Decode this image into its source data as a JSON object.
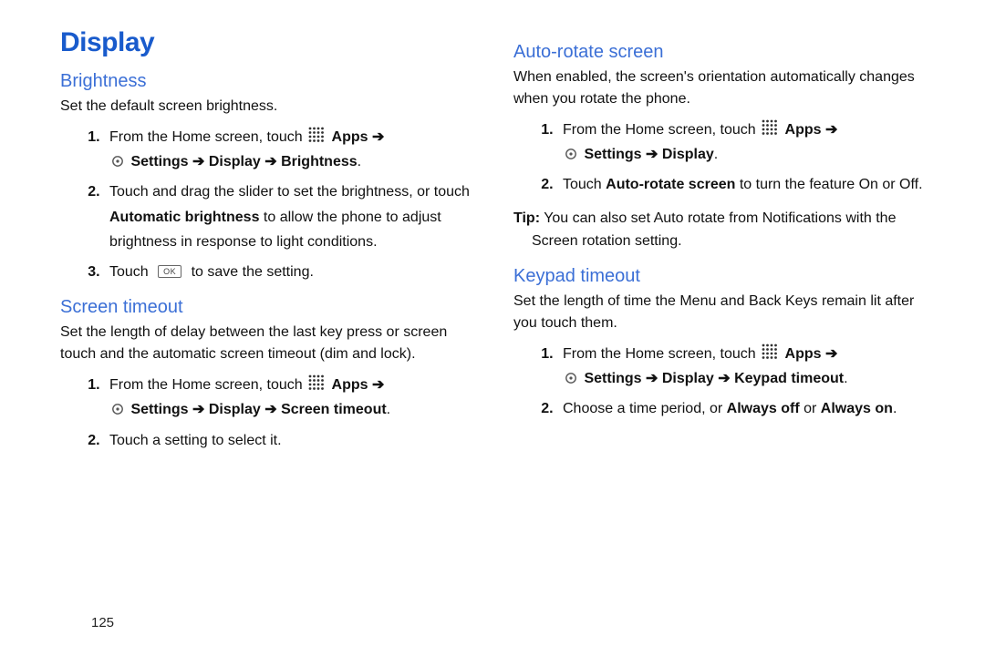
{
  "title": "Display",
  "pageNumber": "125",
  "left": {
    "brightness": {
      "heading": "Brightness",
      "intro": "Set the default screen brightness.",
      "steps": {
        "s1_a": "From the Home screen, touch ",
        "s1_apps": "Apps",
        "s1_arrow": " ➔ ",
        "s1_path": "Settings ➔ Display ➔ Brightness",
        "s1_period": ".",
        "s2_a": "Touch and drag the slider to set the brightness, or touch ",
        "s2_b": "Automatic brightness",
        "s2_c": " to allow the phone to adjust brightness in response to light conditions.",
        "s3_a": "Touch ",
        "s3_ok": "OK",
        "s3_b": " to save the setting."
      }
    },
    "screenTimeout": {
      "heading": "Screen timeout",
      "intro": "Set the length of delay between the last key press or screen touch and the automatic screen timeout (dim and lock).",
      "steps": {
        "s1_a": "From the Home screen, touch ",
        "s1_apps": "Apps",
        "s1_arrow": " ➔ ",
        "s1_path": "Settings ➔ Display ➔ Screen timeout",
        "s1_period": ".",
        "s2": "Touch a setting to select it."
      }
    }
  },
  "right": {
    "autoRotate": {
      "heading": "Auto-rotate screen",
      "intro": "When enabled, the screen's orientation automatically changes when you rotate the phone.",
      "steps": {
        "s1_a": "From the Home screen, touch ",
        "s1_apps": "Apps",
        "s1_arrow": " ➔ ",
        "s1_path": "Settings ➔ Display",
        "s1_period": ".",
        "s2_a": "Touch ",
        "s2_b": "Auto-rotate screen",
        "s2_c": " to turn the feature On or Off."
      },
      "tip_label": "Tip:",
      "tip_text": " You can also set Auto rotate from Notifications with the Screen rotation setting."
    },
    "keypadTimeout": {
      "heading": "Keypad timeout",
      "intro": "Set the length of time the Menu and Back Keys remain lit after you touch them.",
      "steps": {
        "s1_a": "From the Home screen, touch ",
        "s1_apps": "Apps",
        "s1_arrow": " ➔ ",
        "s1_path": "Settings ➔ Display ➔ Keypad timeout",
        "s1_period": ".",
        "s2_a": "Choose a time period, or ",
        "s2_b": "Always off",
        "s2_c": " or ",
        "s2_d": "Always on",
        "s2_e": "."
      }
    }
  }
}
